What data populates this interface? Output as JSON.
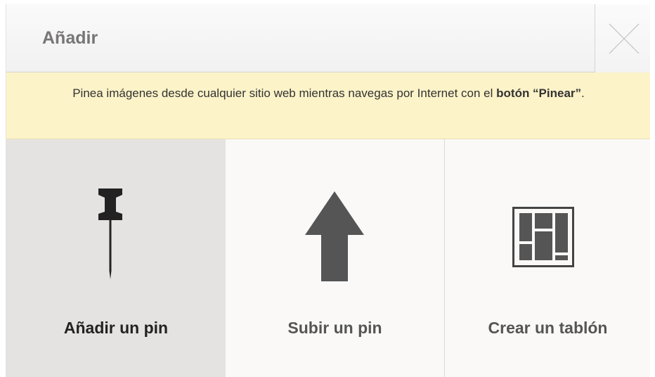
{
  "header": {
    "title": "Añadir",
    "close_icon": "close-icon"
  },
  "notice": {
    "text_before": "Pinea imágenes desde cualquier sitio web mientras navegas por Internet con el ",
    "bold_text": "botón “Pinear”",
    "text_after": "."
  },
  "options": [
    {
      "label": "Añadir un pin",
      "icon": "pushpin-icon",
      "selected": true
    },
    {
      "label": "Subir un pin",
      "icon": "upload-arrow-icon",
      "selected": false
    },
    {
      "label": "Crear un tablón",
      "icon": "board-grid-icon",
      "selected": false
    }
  ],
  "colors": {
    "notice_background": "#fcf3c8",
    "selected_background": "#e5e3e1",
    "icon_dark": "#333333",
    "icon_gray": "#555555"
  }
}
